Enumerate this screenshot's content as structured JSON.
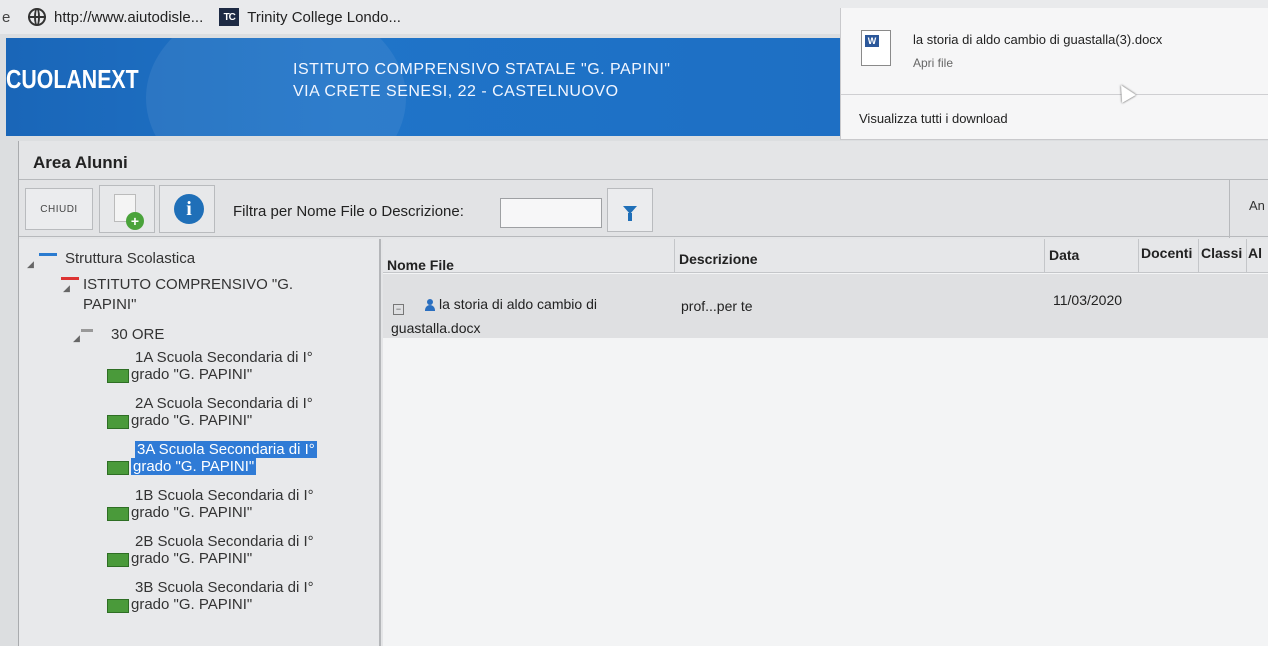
{
  "bookmarks": {
    "edge_char": "e",
    "item1": "http://www.aiutodisle...",
    "item2_logo": "TC",
    "item2": "Trinity College Londo..."
  },
  "banner": {
    "logo": "CUOLANEXT",
    "school_line1": "ISTITUTO COMPRENSIVO STATALE \"G. PAPINI\"",
    "school_line2": "VIA CRETE SENESI, 22 - CASTELNUOVO"
  },
  "download": {
    "file_name": "la storia di aldo cambio di guastalla(3).docx",
    "open_label": "Apri file",
    "view_all": "Visualizza tutti i download"
  },
  "area": {
    "title": "Area Alunni"
  },
  "toolbar": {
    "close_label": "CHIUDI",
    "info_label": "i",
    "filter_label": "Filtra per Nome File o Descrizione:",
    "filter_value": "",
    "right_cut": "An"
  },
  "tree": {
    "root": "Struttura Scolastica",
    "institute_l1": "ISTITUTO COMPRENSIVO \"G.",
    "institute_l2": "PAPINI\"",
    "group": "30 ORE",
    "classes": [
      {
        "l1": "1A Scuola Secondaria di I°",
        "l2": "grado \"G. PAPINI\""
      },
      {
        "l1": "2A Scuola Secondaria di I°",
        "l2": "grado \"G. PAPINI\""
      },
      {
        "l1": "3A Scuola Secondaria di I°",
        "l2": "grado \"G. PAPINI\""
      },
      {
        "l1": "1B Scuola Secondaria di I°",
        "l2": "grado \"G. PAPINI\""
      },
      {
        "l1": "2B Scuola Secondaria di I°",
        "l2": "grado \"G. PAPINI\""
      },
      {
        "l1": "3B Scuola Secondaria di I°",
        "l2": "grado \"G. PAPINI\""
      }
    ],
    "selected_class": "3A Scuola Secondaria di I°"
  },
  "table": {
    "columns": [
      "Nome File",
      "Descrizione",
      "Data",
      "Docenti",
      "Classi",
      "Al"
    ],
    "rows": [
      {
        "expander": "−",
        "name_l1": "la storia di aldo cambio di",
        "name_l2": "guastalla.docx",
        "description": "prof...per te",
        "date": "11/03/2020"
      }
    ]
  },
  "colors": {
    "banner_blue": "#1f74c8",
    "selection_blue": "#2f7bd6",
    "class_icon_green": "#4a9a3a"
  }
}
